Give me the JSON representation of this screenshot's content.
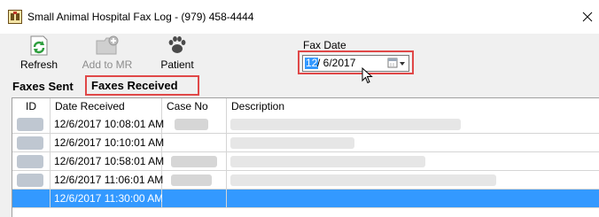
{
  "window": {
    "title": "Small Animal Hospital Fax Log - (979) 458-4444"
  },
  "toolbar": {
    "refresh_label": "Refresh",
    "add_to_mr_label": "Add to MR",
    "patient_label": "Patient"
  },
  "fax_date": {
    "label": "Fax Date",
    "month": "12",
    "rest": "/  6/2017"
  },
  "tabs": {
    "sent": "Faxes Sent",
    "received": "Faxes Received"
  },
  "grid": {
    "headers": [
      "ID",
      "Date Received",
      "Case No",
      "Description"
    ],
    "rows": [
      {
        "date_received": "12/6/2017 10:08:01 AM"
      },
      {
        "date_received": "12/6/2017 10:10:01 AM"
      },
      {
        "date_received": "12/6/2017 10:58:01 AM"
      },
      {
        "date_received": "12/6/2017 11:06:01 AM"
      },
      {
        "date_received": "12/6/2017 11:30:00 AM",
        "selected": true
      }
    ]
  },
  "colors": {
    "highlight": "#e04848",
    "selection": "#3399ff",
    "refresh_icon": "#2e9e3e"
  }
}
